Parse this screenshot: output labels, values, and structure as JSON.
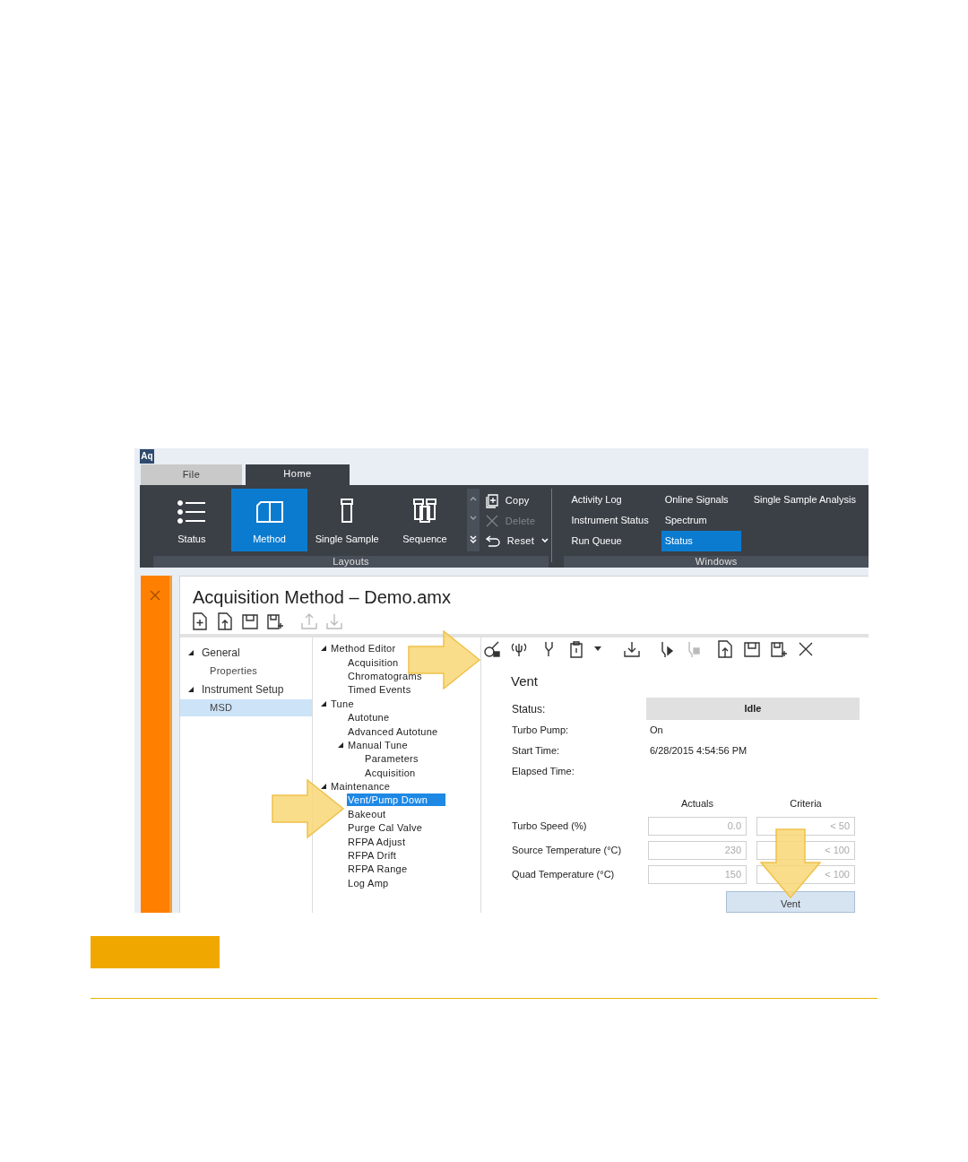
{
  "app_logo": "Aq",
  "tabs": [
    {
      "label": "File",
      "selected": false
    },
    {
      "label": "Home",
      "selected": true
    }
  ],
  "layouts": {
    "label": "Layouts",
    "buttons": [
      {
        "label": "Status",
        "kind": "list",
        "selected": false
      },
      {
        "label": "Method",
        "kind": "book",
        "selected": true
      },
      {
        "label": "Single Sample",
        "kind": "vial",
        "selected": false
      },
      {
        "label": "Sequence",
        "kind": "vials",
        "selected": false
      }
    ]
  },
  "edit_actions": [
    {
      "label": "Copy",
      "kind": "copy",
      "disabled": false,
      "dropdown": false
    },
    {
      "label": "Delete",
      "kind": "delete",
      "disabled": true,
      "dropdown": false
    },
    {
      "label": "Reset",
      "kind": "reset",
      "disabled": false,
      "dropdown": true
    }
  ],
  "windows": {
    "label": "Windows",
    "columns": [
      [
        {
          "label": "Activity Log",
          "selected": false
        },
        {
          "label": "Instrument Status",
          "selected": false
        },
        {
          "label": "Run Queue",
          "selected": false
        }
      ],
      [
        {
          "label": "Online Signals",
          "selected": false
        },
        {
          "label": "Spectrum",
          "selected": false
        },
        {
          "label": "Status",
          "selected": true
        }
      ],
      [
        {
          "label": "Single Sample Analysis",
          "selected": false
        }
      ]
    ]
  },
  "document": {
    "title": "Acquisition Method – Demo.amx"
  },
  "nav": [
    {
      "label": "General",
      "expanded": true,
      "children": [
        {
          "label": "Properties",
          "selected": false
        }
      ]
    },
    {
      "label": "Instrument Setup",
      "expanded": true,
      "children": [
        {
          "label": "MSD",
          "selected": true
        }
      ]
    }
  ],
  "tree": [
    {
      "label": "Method Editor",
      "expanded": true,
      "children": [
        {
          "label": "Acquisition",
          "selected": false
        },
        {
          "label": "Chromatograms",
          "selected": false
        },
        {
          "label": "Timed Events",
          "selected": false
        }
      ]
    },
    {
      "label": "Tune",
      "expanded": true,
      "children": [
        {
          "label": "Autotune",
          "selected": false
        },
        {
          "label": "Advanced Autotune",
          "selected": false
        },
        {
          "label": "Manual Tune",
          "expanded": true,
          "children": [
            {
              "label": "Parameters",
              "selected": false
            },
            {
              "label": "Acquisition",
              "selected": false
            }
          ]
        }
      ]
    },
    {
      "label": "Maintenance",
      "expanded": true,
      "children": [
        {
          "label": "Vent/Pump Down",
          "selected": true
        },
        {
          "label": "Bakeout",
          "selected": false
        },
        {
          "label": "Purge Cal Valve",
          "selected": false
        },
        {
          "label": "RFPA Adjust",
          "selected": false
        },
        {
          "label": "RFPA Drift",
          "selected": false
        },
        {
          "label": "RFPA Range",
          "selected": false
        },
        {
          "label": "Log Amp",
          "selected": false
        }
      ]
    }
  ],
  "vent": {
    "title": "Vent",
    "fields": [
      {
        "label": "Status:",
        "value": "Idle",
        "kind": "status"
      },
      {
        "label": "Turbo Pump:",
        "value": "On",
        "kind": "text"
      },
      {
        "label": "Start Time:",
        "value": "6/28/2015 4:54:56 PM",
        "kind": "text"
      },
      {
        "label": "Elapsed Time:",
        "kind": "text"
      }
    ],
    "columns": [
      "Actuals",
      "Criteria"
    ],
    "rows": [
      {
        "label": "Turbo Speed (%)",
        "actual": "0.0",
        "criteria": "< 50"
      },
      {
        "label": "Source Temperature (°C)",
        "actual": "230",
        "criteria": "< 100"
      },
      {
        "label": "Quad Temperature (°C)",
        "actual": "150",
        "criteria": "< 100"
      }
    ],
    "button": "Vent"
  }
}
